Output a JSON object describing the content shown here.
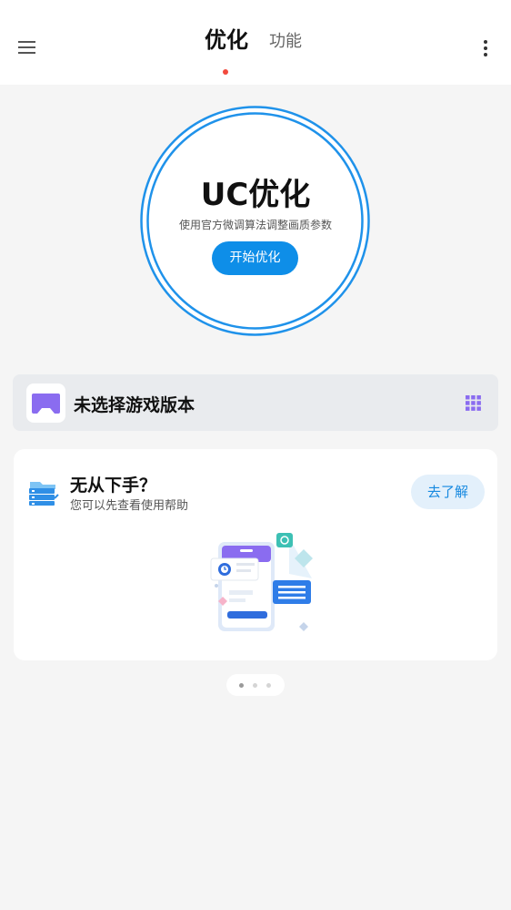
{
  "header": {
    "tabs": [
      {
        "label": "优化",
        "active": true
      },
      {
        "label": "功能",
        "active": false
      }
    ],
    "menu_icon": "hamburger-menu-icon",
    "more_icon": "more-vertical-icon"
  },
  "optimize": {
    "title": "UC优化",
    "subtitle": "使用官方微调算法调整画质参数",
    "start_button": "开始优化"
  },
  "game_version": {
    "label": "未选择游戏版本",
    "icon": "gamepad-icon",
    "grid_icon": "grid-icon"
  },
  "help_card": {
    "title": "无从下手？",
    "subtitle": "您可以先查看使用帮助",
    "button": "去了解",
    "icon": "folder-list-icon",
    "illustration": "phone-help-illustration"
  },
  "pager": {
    "count": 3,
    "active_index": 0
  },
  "colors": {
    "accent": "#0e8ee8",
    "tab_indicator": "#f24a3d",
    "page_bg": "#f5f5f5",
    "game_icon": "#8a6cf0"
  }
}
